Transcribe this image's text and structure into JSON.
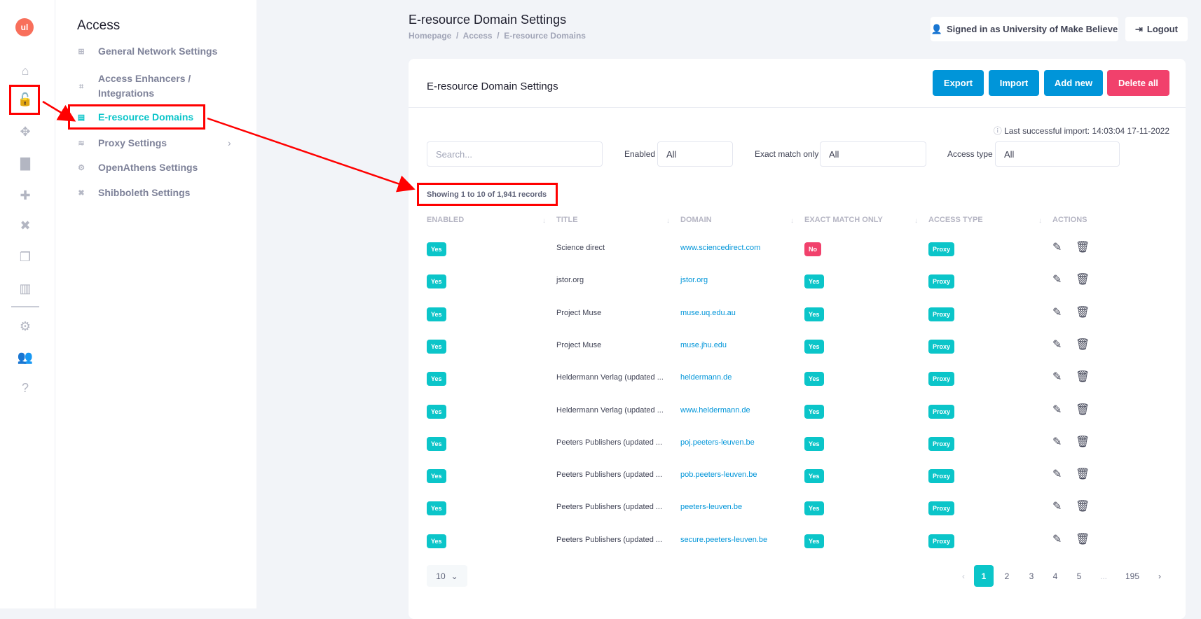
{
  "rail": {
    "logo": "ul",
    "items": [
      {
        "icon": "home-icon",
        "glyph": "⌂"
      },
      {
        "icon": "unlock-icon",
        "glyph": "🔓",
        "active": true
      },
      {
        "icon": "arrows-move-icon",
        "glyph": "✥"
      },
      {
        "icon": "comment-icon",
        "glyph": "▇"
      },
      {
        "icon": "puzzle-icon",
        "glyph": "✚"
      },
      {
        "icon": "tools-icon",
        "glyph": "✖"
      },
      {
        "icon": "copy-icon",
        "glyph": "❐"
      },
      {
        "icon": "chart-icon",
        "glyph": "▥"
      }
    ],
    "bottom": [
      {
        "icon": "gear-icon",
        "glyph": "⚙"
      },
      {
        "icon": "users-icon",
        "glyph": "👥"
      },
      {
        "icon": "help-icon",
        "glyph": "?"
      }
    ]
  },
  "sidebar": {
    "heading": "Access",
    "items": [
      {
        "label": "General Network Settings",
        "icon": "network-icon",
        "glyph": "⊞"
      },
      {
        "label": "Access Enhancers / Integrations",
        "line1": "Access Enhancers /",
        "line2": "Integrations",
        "icon": "integrations-icon",
        "glyph": "⌗"
      },
      {
        "label": "E-resource Domains",
        "icon": "list-icon",
        "glyph": "▤",
        "active": true
      },
      {
        "label": "Proxy Settings",
        "icon": "database-icon",
        "glyph": "≋",
        "has_submenu": true
      },
      {
        "label": "OpenAthens Settings",
        "icon": "cogs-icon",
        "glyph": "⚙"
      },
      {
        "label": "Shibboleth Settings",
        "icon": "tools-icon",
        "glyph": "✖"
      }
    ]
  },
  "header": {
    "title": "E-resource Domain Settings",
    "breadcrumb": "Homepage  /  Access  /  E-resource Domains",
    "signed_in": "Signed in as University of Make Believe",
    "logout": "Logout"
  },
  "card": {
    "title": "E-resource Domain Settings",
    "buttons": {
      "export": "Export",
      "import": "Import",
      "add_new": "Add new",
      "delete_all": "Delete all"
    },
    "last_import": "Last successful import: 14:03:04 17-11-2022",
    "filters": {
      "search_placeholder": "Search...",
      "enabled_label": "Enabled",
      "enabled_value": "All",
      "exact_label": "Exact match only",
      "exact_value": "All",
      "access_label": "Access type",
      "access_value": "All"
    },
    "showing": "Showing 1 to 10 of 1,941 records",
    "columns": [
      "ENABLED",
      "TITLE",
      "DOMAIN",
      "EXACT MATCH ONLY",
      "ACCESS TYPE",
      "ACTIONS"
    ],
    "rows": [
      {
        "enabled": "Yes",
        "title": "Science direct",
        "domain": "www.sciencedirect.com",
        "exact": "No",
        "access": "Proxy"
      },
      {
        "enabled": "Yes",
        "title": "jstor.org",
        "domain": "jstor.org",
        "exact": "Yes",
        "access": "Proxy"
      },
      {
        "enabled": "Yes",
        "title": "Project Muse",
        "domain": "muse.uq.edu.au",
        "exact": "Yes",
        "access": "Proxy"
      },
      {
        "enabled": "Yes",
        "title": "Project Muse",
        "domain": "muse.jhu.edu",
        "exact": "Yes",
        "access": "Proxy"
      },
      {
        "enabled": "Yes",
        "title": "Heldermann Verlag (updated ...",
        "domain": "heldermann.de",
        "exact": "Yes",
        "access": "Proxy"
      },
      {
        "enabled": "Yes",
        "title": "Heldermann Verlag (updated ...",
        "domain": "www.heldermann.de",
        "exact": "Yes",
        "access": "Proxy"
      },
      {
        "enabled": "Yes",
        "title": "Peeters Publishers (updated ...",
        "domain": "poj.peeters-leuven.be",
        "exact": "Yes",
        "access": "Proxy"
      },
      {
        "enabled": "Yes",
        "title": "Peeters Publishers (updated ...",
        "domain": "pob.peeters-leuven.be",
        "exact": "Yes",
        "access": "Proxy"
      },
      {
        "enabled": "Yes",
        "title": "Peeters Publishers (updated ...",
        "domain": "peeters-leuven.be",
        "exact": "Yes",
        "access": "Proxy"
      },
      {
        "enabled": "Yes",
        "title": "Peeters Publishers (updated ...",
        "domain": "secure.peeters-leuven.be",
        "exact": "Yes",
        "access": "Proxy"
      }
    ],
    "per_page": "10",
    "pagination": {
      "prev": "‹",
      "pages": [
        "1",
        "2",
        "3",
        "4",
        "5"
      ],
      "ellipsis": "...",
      "last": "195",
      "next": "›",
      "current": "1"
    }
  },
  "colors": {
    "accent": "#0bc5c9",
    "primary": "#0095d9",
    "danger": "#f1416c",
    "annotation": "#ff0000"
  }
}
